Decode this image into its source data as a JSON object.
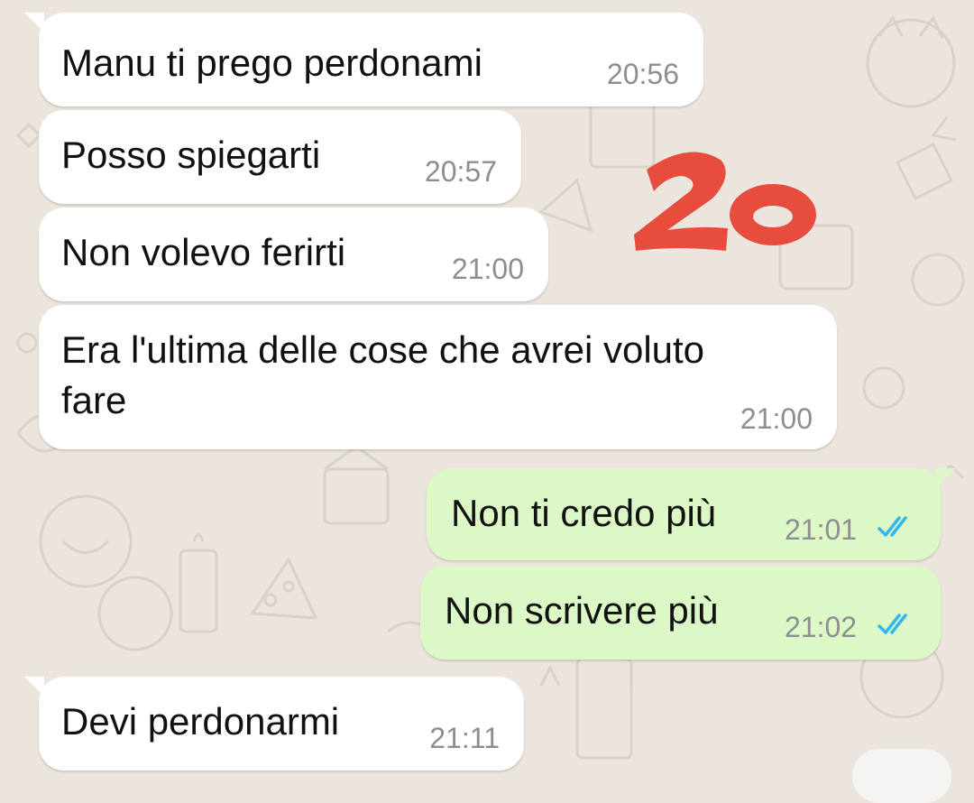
{
  "chat": {
    "messages": [
      {
        "id": "m1",
        "direction": "incoming",
        "text": "Manu ti prego perdonami",
        "time": "20:56"
      },
      {
        "id": "m2",
        "direction": "incoming",
        "text": "Posso spiegarti",
        "time": "20:57"
      },
      {
        "id": "m3",
        "direction": "incoming",
        "text": "Non volevo ferirti",
        "time": "21:00"
      },
      {
        "id": "m4",
        "direction": "incoming",
        "text": "Era l'ultima delle cose che avrei voluto\nfare",
        "time": "21:00"
      },
      {
        "id": "m5",
        "direction": "outgoing",
        "text": "Non ti credo più",
        "time": "21:01",
        "status": "read"
      },
      {
        "id": "m6",
        "direction": "outgoing",
        "text": "Non scrivere più",
        "time": "21:02",
        "status": "read"
      },
      {
        "id": "m7",
        "direction": "incoming",
        "text": "Devi perdonarmi",
        "time": "21:11"
      }
    ]
  },
  "overlay": {
    "sticker_text": "20",
    "sticker_color": "#e84c3d"
  },
  "colors": {
    "wallpaper": "#ece5dd",
    "incoming_bubble": "#ffffff",
    "outgoing_bubble": "#dcf8c6",
    "time_text": "#8e8e8e",
    "read_ticks": "#34b7f1"
  },
  "icons": {
    "read_receipt": "double-check-icon"
  }
}
